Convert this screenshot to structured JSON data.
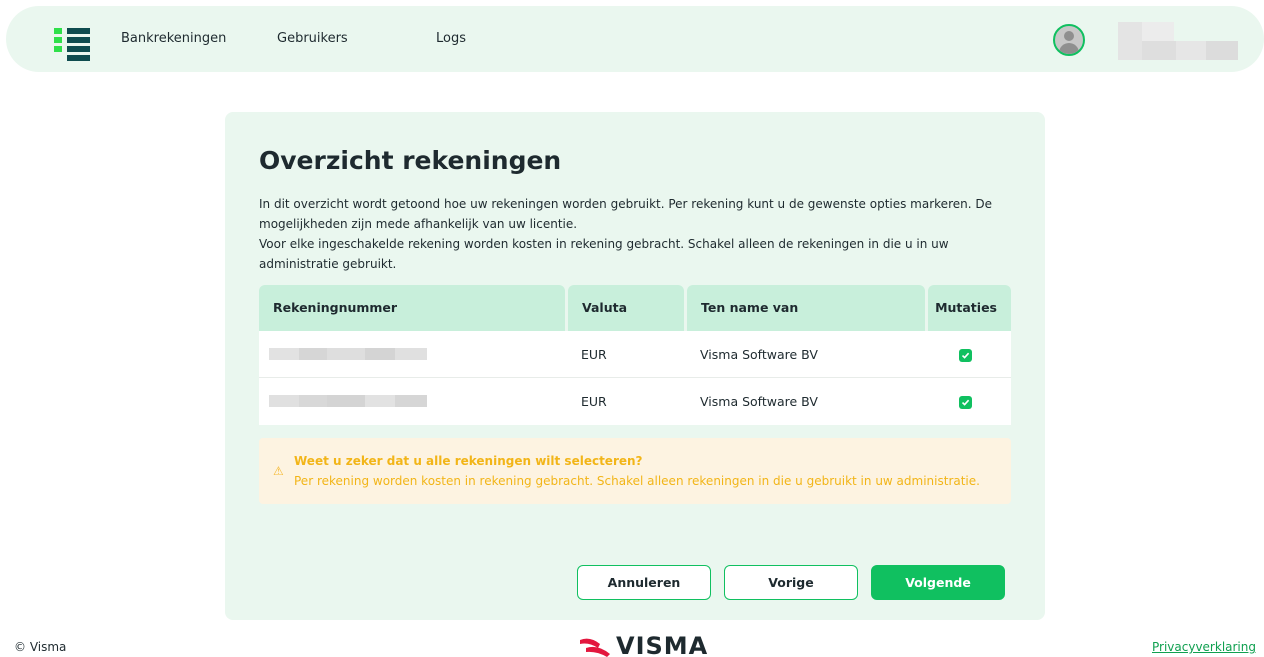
{
  "nav": {
    "items": [
      {
        "label": "Bankrekeningen"
      },
      {
        "label": "Gebruikers"
      },
      {
        "label": "Logs"
      }
    ],
    "logo_icon": "brand-menu-icon",
    "avatar_icon": "user-avatar-icon"
  },
  "card": {
    "title": "Overzicht rekeningen",
    "intro_line1": "In dit overzicht wordt getoond hoe uw rekeningen worden gebruikt. Per rekening kunt u de gewenste opties markeren. De mogelijkheden zijn mede afhankelijk van uw licentie.",
    "intro_line2": "Voor elke ingeschakelde rekening worden kosten in rekening gebracht. Schakel alleen de rekeningen in die u in uw administratie gebruikt."
  },
  "table": {
    "headers": {
      "account": "Rekeningnummer",
      "currency": "Valuta",
      "holder": "Ten name van",
      "mutations": "Mutaties"
    },
    "rows": [
      {
        "currency": "EUR",
        "holder": "Visma Software BV",
        "mutations_checked": true
      },
      {
        "currency": "EUR",
        "holder": "Visma Software BV",
        "mutations_checked": true
      }
    ]
  },
  "warning": {
    "icon": "warning-icon",
    "title": "Weet u zeker dat u alle rekeningen wilt selecteren?",
    "text": "Per rekening worden kosten in rekening gebracht. Schakel alleen rekeningen in die u gebruikt in uw administratie."
  },
  "buttons": {
    "cancel": "Annuleren",
    "previous": "Vorige",
    "next": "Volgende"
  },
  "footer": {
    "copyright": "© Visma",
    "brand": "VISMA",
    "privacy": "Privacyverklaring"
  },
  "colors": {
    "accent": "#10c060",
    "card_bg": "#eaf7ef",
    "header_bg": "#c8efdb",
    "warning_bg": "#fdf3e1",
    "warning_text": "#f2b518",
    "text": "#1e2a2f"
  }
}
